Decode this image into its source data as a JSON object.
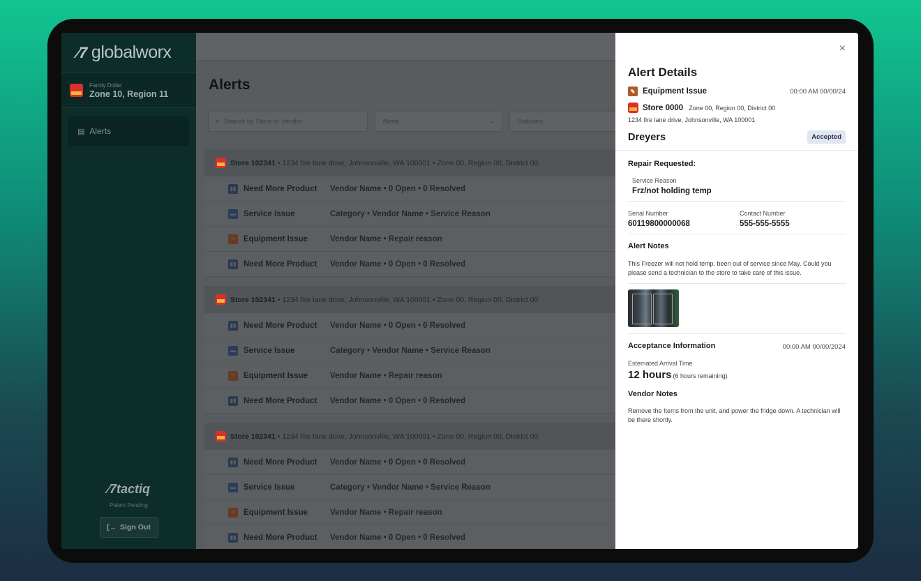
{
  "sidebar": {
    "logo": "globalworx",
    "brand": "Family Dollar",
    "zone": "Zone 10, Region 11",
    "nav": [
      {
        "label": "Alerts",
        "icon": "document-icon"
      }
    ],
    "footer_logo": "tactiq",
    "patent": "Patent Pending",
    "signout": "Sign Out"
  },
  "main": {
    "title": "Alerts",
    "search_placeholder": "Search by Store or Vendor",
    "alerts_filter": "Alerts",
    "statuses_filter": "Statuses",
    "groups": [
      {
        "store": "Store 102341",
        "info": "• 1234 fire lane drive, Johnsonville, WA 100001 • Zone 00, Region 00, District 00",
        "rows": [
          {
            "type": "Need More Product",
            "detail": "Vendor Name • 0 Open • 0 Resolved"
          },
          {
            "type": "Service Issue",
            "detail": "Category • Vendor Name • Service Reason"
          },
          {
            "type": "Equipment Issue",
            "detail": "Vendor Name • Repair reason"
          },
          {
            "type": "Need More Product",
            "detail": "Vendor Name • 0 Open • 0 Resolved"
          }
        ]
      },
      {
        "store": "Store 102341",
        "info": "• 1234 fire lane drive, Johnsonville, WA 100001 • Zone 00, Region 00, District 00",
        "rows": [
          {
            "type": "Need More Product",
            "detail": "Vendor Name • 0 Open • 0 Resolved"
          },
          {
            "type": "Service Issue",
            "detail": "Category • Vendor Name • Service Reason"
          },
          {
            "type": "Equipment Issue",
            "detail": "Vendor Name • Repair reason"
          },
          {
            "type": "Need More Product",
            "detail": "Vendor Name • 0 Open • 0 Resolved"
          }
        ]
      },
      {
        "store": "Store 102341",
        "info": "• 1234 fire lane drive, Johnsonville, WA 100001 • Zone 00, Region 00, District 00",
        "rows": [
          {
            "type": "Need More Product",
            "detail": "Vendor Name • 0 Open • 0 Resolved"
          },
          {
            "type": "Service Issue",
            "detail": "Category • Vendor Name • Service Reason"
          },
          {
            "type": "Equipment Issue",
            "detail": "Vendor Name • Repair reason"
          },
          {
            "type": "Need More Product",
            "detail": "Vendor Name • 0 Open • 0 Resolved"
          }
        ]
      }
    ]
  },
  "panel": {
    "close": "×",
    "title": "Alert Details",
    "alert_type": "Equipment Issue",
    "alert_time": "00:00 AM 00/00/24",
    "store": "Store 0000",
    "store_region": "Zone 00, Region 00, District 00",
    "address": "1234 fire lane drive, Johnsonville, WA 100001",
    "vendor": "Dreyers",
    "status": "Accepted",
    "repair_heading": "Repair Requested:",
    "service_reason_label": "Service Reason",
    "service_reason": "Frz/not holding temp",
    "serial_label": "Serial Number",
    "serial": "60119800000068",
    "contact_label": "Contact Number",
    "contact": "555-555-5555",
    "notes_heading": "Alert Notes",
    "notes": "This Freezer will not hold temp. been out of service since May. Could you please send a technician to the store to take care of this issue.",
    "acceptance_heading": "Acceptance Information",
    "acceptance_time": "00:00 AM 00/00/2024",
    "eta_label": "Estemated Arrival Time",
    "eta": "12 hours",
    "eta_remaining": "(6 hours remaining)",
    "vendor_notes_heading": "Vendor Notes",
    "vendor_notes": "Remove the Items from the unit, and power the fridge down. A technician will be there shortly."
  }
}
